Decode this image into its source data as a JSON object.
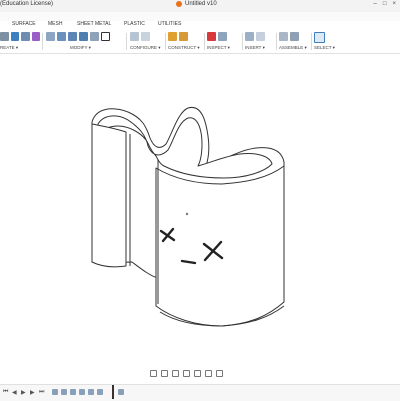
{
  "titlebar": {
    "app_title": "(Education License)",
    "doc_title": "Untitled v10"
  },
  "tabs": [
    "SURFACE",
    "MESH",
    "SHEET METAL",
    "PLASTIC",
    "UTILITIES"
  ],
  "ribbon": {
    "groups": [
      {
        "label": "REATE ▾"
      },
      {
        "label": "MODIFY ▾"
      },
      {
        "label": "CONFIGURE ▾"
      },
      {
        "label": "CONSTRUCT ▾"
      },
      {
        "label": "INSPECT ▾"
      },
      {
        "label": "INSERT ▾"
      },
      {
        "label": "ASSEMBLE ▾"
      },
      {
        "label": "SELECT ▾"
      }
    ]
  },
  "model": {
    "face_text": "x_x"
  },
  "colors": {
    "accent": "#e8711a",
    "model_stroke": "#333333",
    "ribbon_blue": "#3e7fc1"
  },
  "icons": {
    "window_controls": [
      "minimize-icon",
      "maximize-icon",
      "close-icon"
    ],
    "navbar": [
      "orbit-icon",
      "pan-icon",
      "zoom-icon",
      "fit-icon",
      "display-settings-icon",
      "grid-icon",
      "viewports-icon"
    ],
    "timeline": [
      "first-icon",
      "previous-icon",
      "play-icon",
      "next-icon",
      "last-icon"
    ]
  }
}
